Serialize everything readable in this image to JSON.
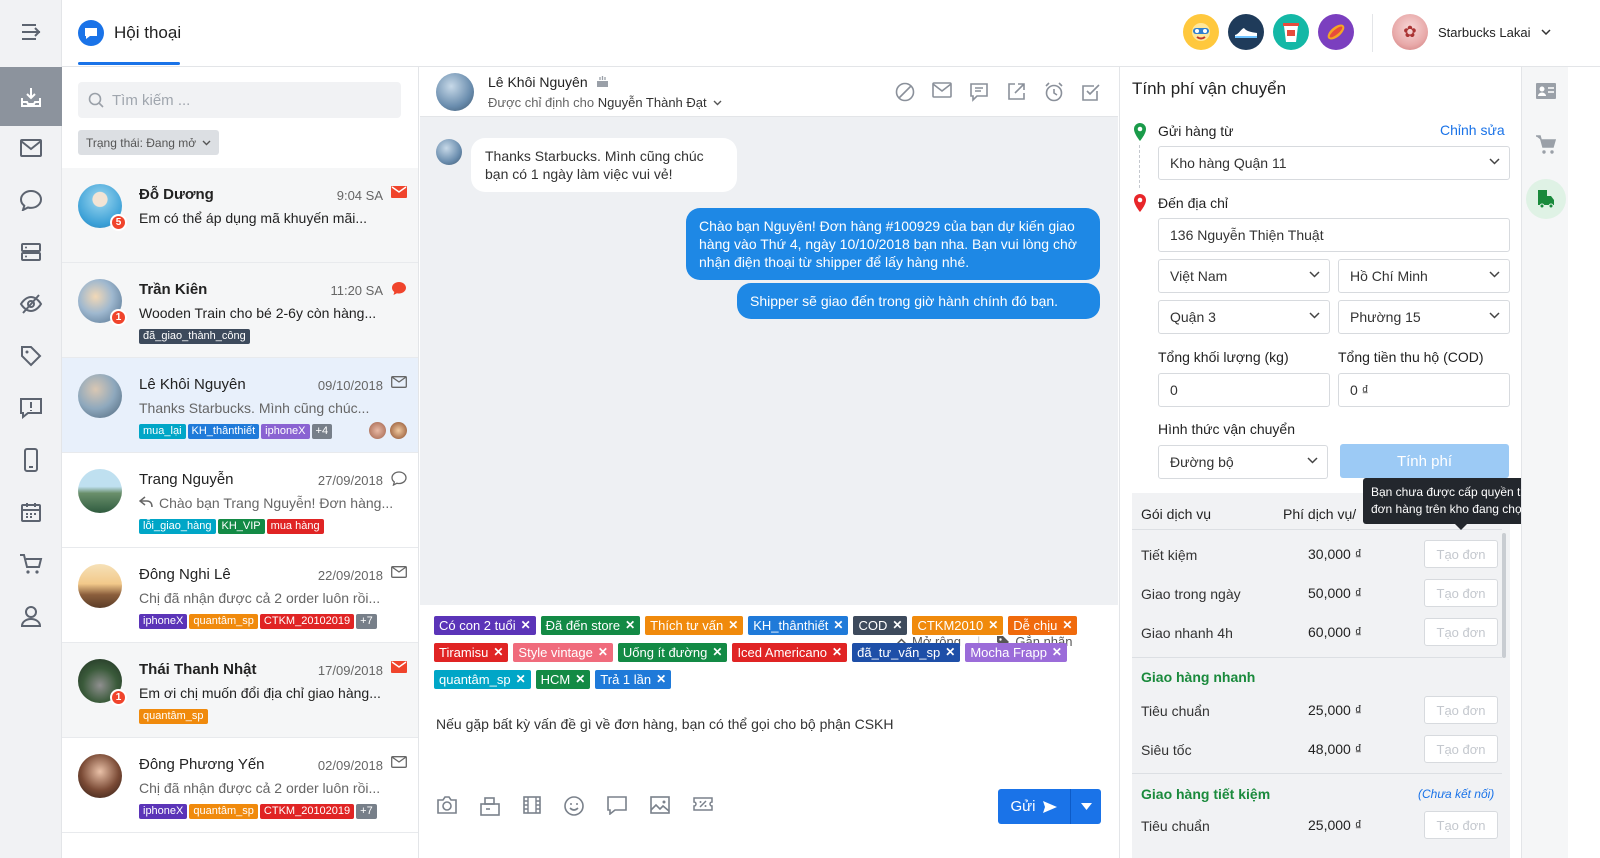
{
  "header": {
    "title": "Hội thoại",
    "account_name": "Starbucks Lakai"
  },
  "search": {
    "placeholder": "Tìm kiếm ..."
  },
  "status_filter": "Trạng thái: Đang mở",
  "conversations": [
    {
      "name": "Đỗ Dương",
      "time": "9:04 SA",
      "preview": "Em có thể áp dụng mã khuyến mãi...",
      "badge": "5",
      "icon": "mail-icon",
      "unread": true,
      "tags": []
    },
    {
      "name": "Trần Kiên",
      "time": "11:20 SA",
      "preview": "Wooden Train cho bé 2-6y còn hàng...",
      "badge": "1",
      "icon": "chat-bubble-icon",
      "unread": true,
      "tags": [
        {
          "label": "đã_giao_thành_công",
          "color": "#3d4a5c"
        }
      ]
    },
    {
      "name": "Lê Khôi Nguyên",
      "time": "09/10/2018",
      "preview": "Thanks Starbucks. Mình cũng chúc...",
      "icon": "mail-outline-icon",
      "selected": true,
      "tags": [
        {
          "label": "mua_lại",
          "color": "#00a6c7"
        },
        {
          "label": "KH_thânthiết",
          "color": "#1f7ad9"
        },
        {
          "label": "iphoneX",
          "color": "#8a63d2"
        },
        {
          "label": "+4",
          "color": "#777f89"
        }
      ]
    },
    {
      "name": "Trang Nguyễn",
      "time": "27/09/2018",
      "preview": "Chào bạn Trang Nguyễn! Đơn hàng...",
      "icon": "chat-outline-icon",
      "reply": true,
      "tags": [
        {
          "label": "lỗi_giao_hàng",
          "color": "#00a6c7"
        },
        {
          "label": "KH_VIP",
          "color": "#138a45"
        },
        {
          "label": "mua hàng",
          "color": "#e02424"
        }
      ]
    },
    {
      "name": "Đông Nghi Lê",
      "time": "22/09/2018",
      "preview": "Chị đã nhận được cả 2 order luôn rồi...",
      "icon": "mail-outline-icon",
      "tags": [
        {
          "label": "iphoneX",
          "color": "#5b34b8"
        },
        {
          "label": "quantâm_sp",
          "color": "#f08a0c"
        },
        {
          "label": "CTKM_20102019",
          "color": "#e02424"
        },
        {
          "label": "+7",
          "color": "#777f89"
        }
      ]
    },
    {
      "name": "Thái Thanh Nhật",
      "time": "17/09/2018",
      "preview": "Em ơi chị muốn đổi địa chỉ giao hàng...",
      "badge": "1",
      "icon": "mail-icon",
      "unread": true,
      "tags": [
        {
          "label": "quantâm_sp",
          "color": "#f08a0c"
        }
      ]
    },
    {
      "name": "Đông Phương Yến",
      "time": "02/09/2018",
      "preview": "Chị đã nhận được cả 2 order luôn rồi...",
      "icon": "mail-outline-icon",
      "tags": [
        {
          "label": "iphoneX",
          "color": "#5b34b8"
        },
        {
          "label": "quantâm_sp",
          "color": "#f08a0c"
        },
        {
          "label": "CTKM_20102019",
          "color": "#e02424"
        },
        {
          "label": "+7",
          "color": "#777f89"
        }
      ]
    }
  ],
  "chat": {
    "contact_name": "Lê Khôi Nguyên",
    "assign_prefix": "Được chỉ định cho",
    "assignee": "Nguyễn Thành Đạt",
    "messages": {
      "incoming": "Thanks Starbucks. Mình cũng chúc bạn có 1 ngày làm việc vui vẻ!",
      "outgoing_1": "Chào bạn Nguyên! Đơn hàng #100929 của bạn dự kiến giao hàng vào Thứ 4, ngày 10/10/2018 bạn nha. Bạn vui lòng chờ nhận điện thoại từ shipper để lấy hàng nhé.",
      "outgoing_2": "Shipper sẽ giao đến trong giờ hành chính đó bạn."
    },
    "expand_label": "Mở rộng",
    "tag_label": "Gắn nhãn",
    "tags": [
      {
        "label": "Có con 2 tuổi",
        "color": "#5b34b8"
      },
      {
        "label": "Đã đến store",
        "color": "#138a45"
      },
      {
        "label": "Thích tư vấn",
        "color": "#f08a0c"
      },
      {
        "label": "KH_thânthiết",
        "color": "#1f7ad9"
      },
      {
        "label": "COD",
        "color": "#3d4a5c"
      },
      {
        "label": "CTKM2010",
        "color": "#f08a0c"
      },
      {
        "label": "Dễ chịu",
        "color": "#f06a0c"
      },
      {
        "label": "Tiramisu",
        "color": "#e02424"
      },
      {
        "label": "Style vintage",
        "color": "#f06b7c"
      },
      {
        "label": "Uống ít đường",
        "color": "#138a45"
      },
      {
        "label": "Iced Americano",
        "color": "#e02424"
      },
      {
        "label": "đã_tư_vấn_sp",
        "color": "#1e4fa8"
      },
      {
        "label": "Mocha Frapp",
        "color": "#9b6cd9"
      },
      {
        "label": "quantâm_sp",
        "color": "#00a6c7"
      },
      {
        "label": "HCM",
        "color": "#138a45"
      },
      {
        "label": "Trả 1 lần",
        "color": "#1f7ad9"
      }
    ],
    "composer_text": "Nếu gặp bất kỳ vấn đề gì về đơn hàng, bạn có thể gọi cho bộ phận CSKH",
    "send_label": "Gửi"
  },
  "shipping": {
    "title": "Tính phí vận chuyển",
    "from_label": "Gửi hàng từ",
    "edit_link": "Chỉnh sửa",
    "warehouse": "Kho hàng Quận 11",
    "to_label": "Đến địa chỉ",
    "address": "136 Nguyễn Thiện Thuật",
    "country": "Việt Nam",
    "city": "Hồ Chí Minh",
    "district": "Quận 3",
    "ward": "Phường 15",
    "weight_label": "Tổng khối lượng (kg)",
    "weight_value": "0",
    "cod_label": "Tổng tiền thu hộ (COD)",
    "cod_value": "0 ₫",
    "method_label": "Hình thức vận chuyển",
    "method": "Đường bộ",
    "calc_button": "Tính phí",
    "col_service": "Gói dịch vụ",
    "col_fee": "Phí dịch vụ/",
    "create_label": "Tạo đơn",
    "groups": [
      {
        "name": "",
        "items": [
          {
            "name": "Tiết kiệm",
            "price": "30,000 ₫"
          },
          {
            "name": "Giao trong ngày",
            "price": "50,000 ₫"
          },
          {
            "name": "Giao nhanh 4h",
            "price": "60,000 ₫"
          }
        ]
      },
      {
        "name": "Giao hàng nhanh",
        "items": [
          {
            "name": "Tiêu chuẩn",
            "price": "25,000 ₫"
          },
          {
            "name": "Siêu tốc",
            "price": "48,000 ₫"
          }
        ]
      },
      {
        "name": "Giao hàng tiết kiệm",
        "status": "(Chưa kết nối)",
        "items": [
          {
            "name": "Tiêu chuẩn",
            "price": "25,000 ₫"
          }
        ]
      }
    ],
    "tooltip": "Bạn chưa được cấp quyền tạo đơn hàng trên kho đang chọn."
  }
}
